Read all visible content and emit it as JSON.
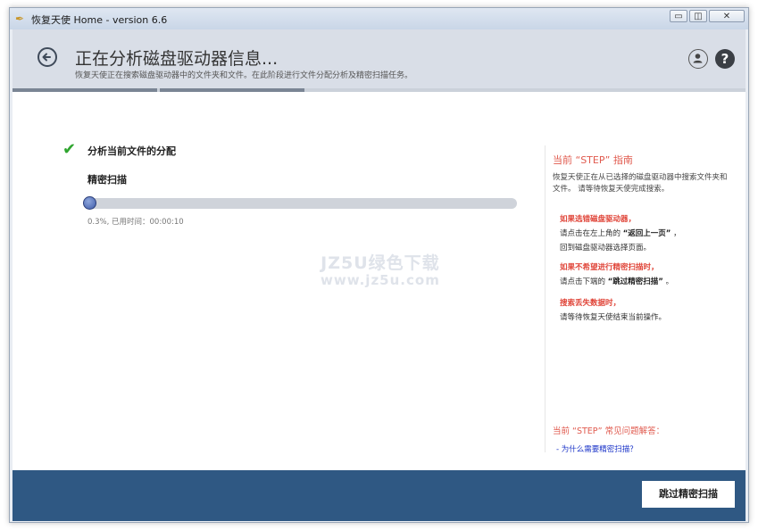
{
  "window": {
    "title": "恢复天使 Home - version 6.6",
    "controls": {
      "minimize": "▭",
      "restore": "◫",
      "close": "✕"
    }
  },
  "header": {
    "title": "正在分析磁盘驱动器信息...",
    "subtitle": "恢复天使正在搜索磁盘驱动器中的文件夹和文件。在此阶段进行文件分配分析及精密扫描任务。",
    "help_label": "?"
  },
  "steps": {
    "total": 5,
    "current": 2
  },
  "task": {
    "main_label": "分析当前文件的分配",
    "sub_label": "精密扫描",
    "progress_fraction": 0.003,
    "progress_text": "0.3%, 已用时间：00:00:10"
  },
  "watermark": {
    "line1": "JZ5U绿色下载",
    "line2": "www.jz5u.com"
  },
  "guide": {
    "title": "当前 “STEP” 指南",
    "description": "恢复天使正在从已选择的磁盘驱动器中搜索文件夹和文件。 请等待恢复天使完成搜索。",
    "tips": [
      {
        "heading": "如果选错磁盘驱动器，",
        "line1_prefix": "请点击在左上角的",
        "line1_bold": "“返回上一页”",
        "line1_suffix": "，",
        "line2": "回到磁盘驱动器选择页面。"
      },
      {
        "heading": "如果不希望进行精密扫描时，",
        "line1_prefix": "请点击下端的",
        "line1_bold": "“跳过精密扫描”",
        "line1_suffix": "。",
        "line2": ""
      },
      {
        "heading": "搜索丢失数据时，",
        "line1_prefix": "请等待恢复天使结束当前操作。",
        "line1_bold": "",
        "line1_suffix": "",
        "line2": ""
      }
    ],
    "faq_title": "当前 “STEP” 常见问题解答：",
    "faq_link": "- 为什么需要精密扫描？"
  },
  "footer": {
    "skip_label": "跳过精密扫描"
  },
  "colors": {
    "footer_bg": "#2f5883",
    "accent_red": "#e05a4e",
    "check_green": "#2fa52f",
    "link_blue": "#1a33c8"
  }
}
